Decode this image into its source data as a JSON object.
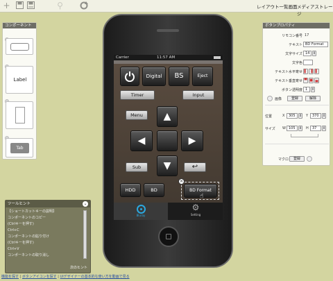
{
  "toolbar": {
    "add_icon": "plus-icon",
    "save_icon": "save-icon",
    "save_as_icon": "save-as-icon",
    "search_icon": "search-icon",
    "refresh_icon": "refresh-icon"
  },
  "top_links": {
    "layout_list": "レイアウト一覧画面",
    "media_storage": "メディアストレージ"
  },
  "components_panel": {
    "title": "コンポーネント",
    "label_item": "Label",
    "tab_item": "Tab"
  },
  "properties_panel": {
    "title": "ボタンプロパティ",
    "remocon_no_label": "リモコン番号",
    "remocon_no": "17",
    "text_label": "テキスト",
    "text_value": "BD Format",
    "font_size_label": "文字サイズ",
    "font_size": "14",
    "text_color_label": "文字色",
    "halign_label": "テキスト水平寄せ",
    "valign_label": "テキスト垂直寄せ",
    "opacity_label": "ボタン透明度",
    "opacity": "1",
    "image_label": "画像",
    "register_label": "登録",
    "delete_label": "解除",
    "position_label": "位置",
    "pos_x_label": "X",
    "pos_x": "305",
    "pos_y_label": "Y",
    "pos_y": "370",
    "size_label": "サイズ",
    "size_w_label": "W",
    "size_w": "105",
    "size_h_label": "H",
    "size_h": "37",
    "macro_label": "マクロ",
    "macro_register": "登録"
  },
  "tool_hint": {
    "title": "ツールヒント",
    "lines": [
      "【ショートカットキーの説明】",
      "コンポーネントのコピー",
      "(Ctrlキーを押す)",
      "Ctrl+C",
      "コンポーネントの貼り付け",
      "(Ctrlキーを押す)",
      "Ctrl+V",
      "コンポーネントの取り消し"
    ],
    "next": "次のヒント"
  },
  "phone": {
    "carrier": "Carrier",
    "time": "11:57 AM",
    "buttons": {
      "digital": "Digital",
      "bs": "BS",
      "eject": "Eject",
      "timer": "Timer",
      "input": "Input",
      "menu": "Menu",
      "sub": "Sub",
      "hdd": "HDD",
      "bd": "BD",
      "bd_format": "BD Format"
    },
    "tabs": {
      "bluray": "Bluray",
      "setting": "Setting"
    }
  },
  "bottom_links": {
    "link1": "機能を探す",
    "link2": "ボタンアイコンを探す",
    "link3": "UIデザイナーの基本的な使い方を動画で見る"
  }
}
